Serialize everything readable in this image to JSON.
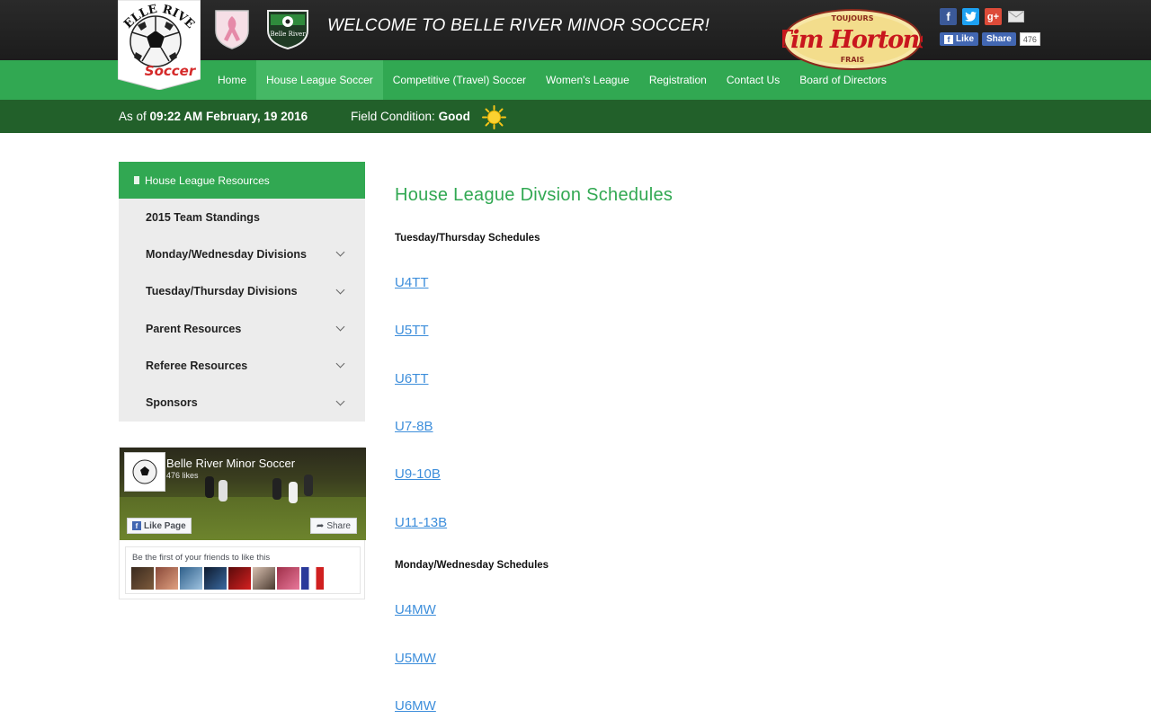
{
  "header": {
    "logo_text_top": "BELLE RIVER",
    "logo_text_bottom": "Soccer",
    "crest_green_text": "Belle River",
    "welcome": "WELCOME TO BELLE RIVER MINOR SOCCER!",
    "sponsor": {
      "main": "Tim Hortons",
      "top": "TOUJOURS",
      "bottom": "FRAIS"
    },
    "social": {
      "fb_like": "Like",
      "fb_share": "Share",
      "fb_count": "476"
    }
  },
  "nav": {
    "items": [
      {
        "label": "Home"
      },
      {
        "label": "House League Soccer",
        "active": true
      },
      {
        "label": "Competitive (Travel) Soccer"
      },
      {
        "label": "Women's League"
      },
      {
        "label": "Registration"
      },
      {
        "label": "Contact Us"
      },
      {
        "label": "Board of Directors"
      }
    ]
  },
  "status": {
    "asof_label": "As of",
    "asof_value": "09:22 AM February, 19 2016",
    "field_label": "Field Condition:",
    "field_value": "Good"
  },
  "sidebar": {
    "header": "House League Resources",
    "items": [
      {
        "label": "2015 Team Standings",
        "expandable": false
      },
      {
        "label": "Monday/Wednesday Divisions",
        "expandable": true
      },
      {
        "label": "Tuesday/Thursday Divisions",
        "expandable": true
      },
      {
        "label": "Parent Resources",
        "expandable": true
      },
      {
        "label": "Referee Resources",
        "expandable": true
      },
      {
        "label": "Sponsors",
        "expandable": true
      }
    ]
  },
  "facebook_widget": {
    "page_name": "Belle River Minor Soccer",
    "likes": "476 likes",
    "like_button": "Like Page",
    "share_button": "Share",
    "friends_text": "Be the first of your friends to like this"
  },
  "main": {
    "title": "House League Divsion Schedules",
    "tt_heading": "Tuesday/Thursday Schedules",
    "tt_links": [
      "U4TT",
      "U5TT",
      "U6TT",
      "U7-8B",
      "U9-10B",
      "U11-13B"
    ],
    "mw_heading": "Monday/Wednesday Schedules",
    "mw_links": [
      "U4MW",
      "U5MW",
      "U6MW"
    ]
  },
  "colors": {
    "nav_green": "#31a852",
    "nav_active": "#45b865",
    "status_green": "#22602a",
    "link_blue": "#3d8edb",
    "sidebar_bg": "#ececec"
  }
}
